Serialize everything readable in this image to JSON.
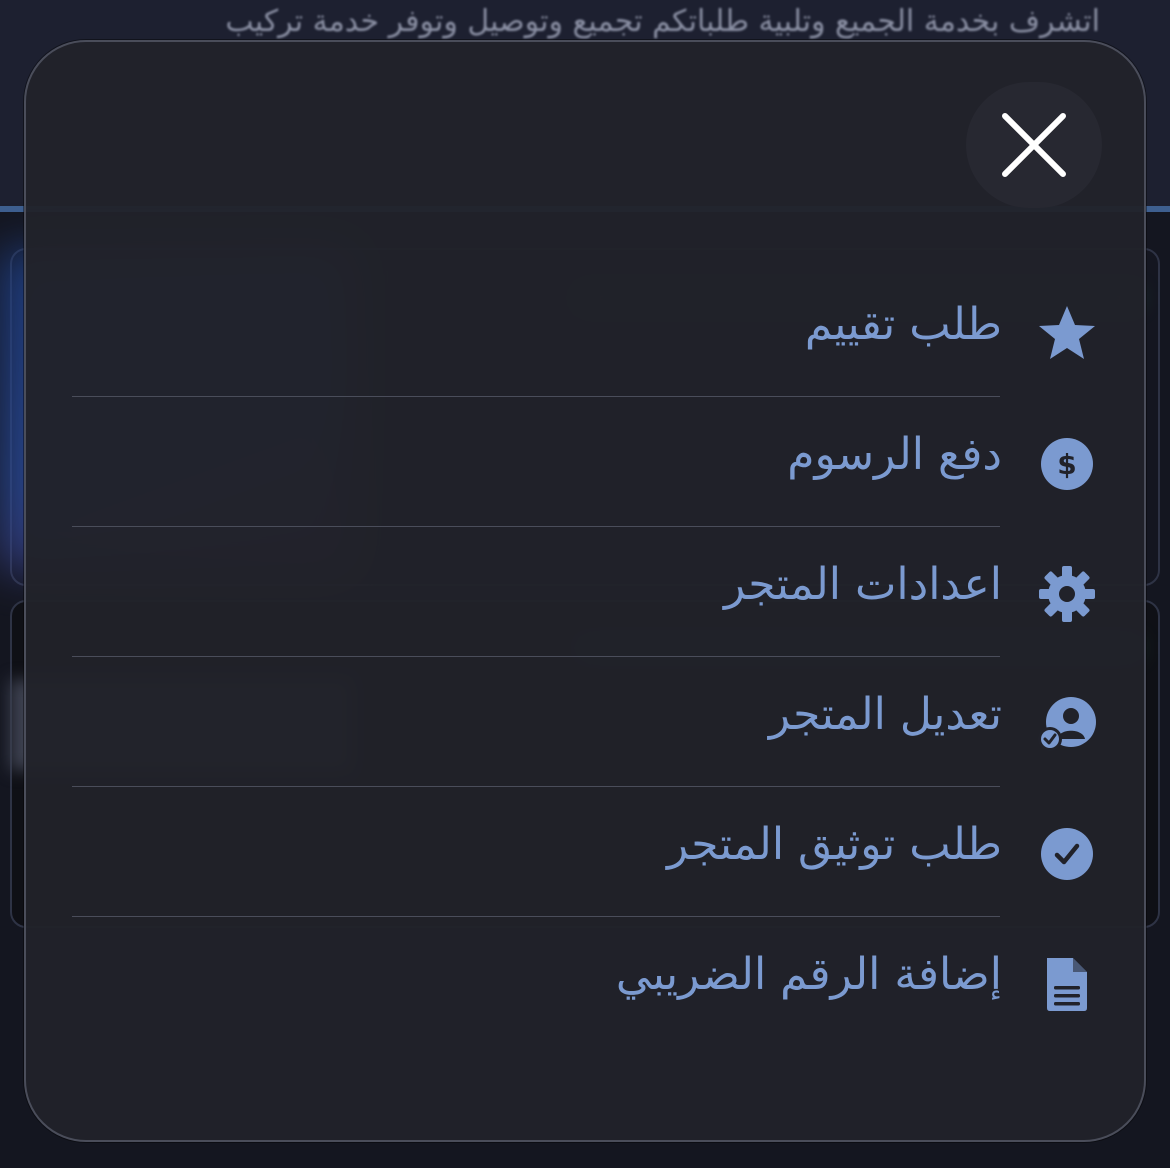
{
  "background": {
    "header_text": "اتشرف بخدمة الجميع وتلبية طلباتكم تجميع وتوصيل وتوفر خدمة تركيب"
  },
  "colors": {
    "accent": "#7b9ad0",
    "modal_bg": "#21222a",
    "separator": "#4a4d5a",
    "close_glyph": "#ffffff"
  },
  "modal": {
    "close_icon": "close-icon",
    "items": [
      {
        "label": "طلب تقييم",
        "icon": "star-icon"
      },
      {
        "label": "دفع الرسوم",
        "icon": "dollar-circle-icon"
      },
      {
        "label": "اعدادات المتجر",
        "icon": "gear-icon"
      },
      {
        "label": "تعديل المتجر",
        "icon": "user-check-icon"
      },
      {
        "label": "طلب توثيق المتجر",
        "icon": "check-circle-icon"
      },
      {
        "label": "إضافة الرقم الضريبي",
        "icon": "document-icon"
      }
    ]
  }
}
